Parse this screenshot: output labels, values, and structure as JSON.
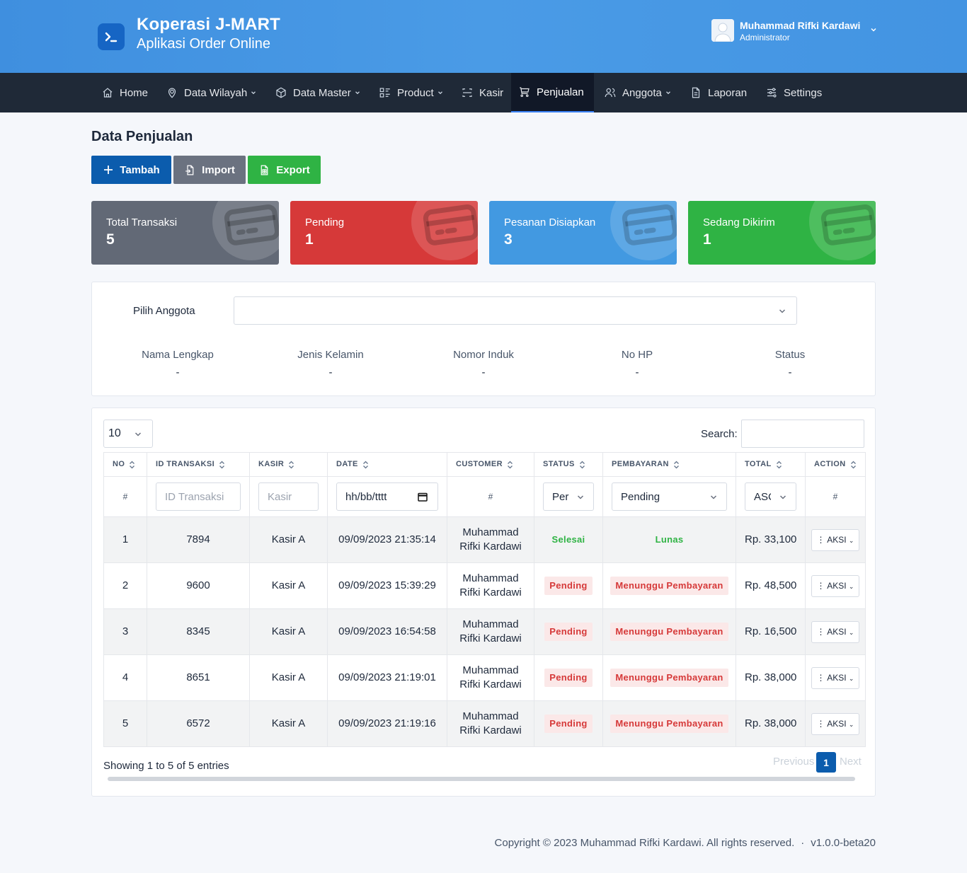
{
  "app": {
    "title": "Koperasi J-MART",
    "subtitle": "Aplikasi Order Online"
  },
  "user": {
    "name": "Muhammad Rifki Kardawi",
    "role": "Administrator"
  },
  "nav": [
    {
      "label": "Home",
      "icon": "home-icon",
      "dropdown": false
    },
    {
      "label": "Data Wilayah",
      "icon": "map-pin-icon",
      "dropdown": true
    },
    {
      "label": "Data Master",
      "icon": "box-icon",
      "dropdown": true
    },
    {
      "label": "Product",
      "icon": "list-details-icon",
      "dropdown": true
    },
    {
      "label": "Kasir",
      "icon": "scan-icon",
      "dropdown": false
    },
    {
      "label": "Penjualan",
      "icon": "cart-icon",
      "dropdown": false,
      "active": true
    },
    {
      "label": "Anggota",
      "icon": "users-icon",
      "dropdown": true
    },
    {
      "label": "Laporan",
      "icon": "file-icon",
      "dropdown": false
    },
    {
      "label": "Settings",
      "icon": "adjustments-icon",
      "dropdown": false
    }
  ],
  "page": {
    "title": "Data Penjualan",
    "buttons": {
      "tambah": "Tambah",
      "import": "Import",
      "export": "Export"
    }
  },
  "stats": [
    {
      "label": "Total Transaksi",
      "value": "5",
      "color": "#626976"
    },
    {
      "label": "Pending",
      "value": "1",
      "color": "#d63939"
    },
    {
      "label": "Pesanan Disiapkan",
      "value": "3",
      "color": "#4299e1"
    },
    {
      "label": "Sedang Dikirim",
      "value": "1",
      "color": "#2fb344"
    }
  ],
  "member": {
    "label": "Pilih Anggota",
    "select_value": "",
    "fields": [
      {
        "label": "Nama Lengkap",
        "value": "-"
      },
      {
        "label": "Jenis Kelamin",
        "value": "-"
      },
      {
        "label": "Nomor Induk",
        "value": "-"
      },
      {
        "label": "No HP",
        "value": "-"
      },
      {
        "label": "Status",
        "value": "-"
      }
    ]
  },
  "table": {
    "length": "10",
    "search_label": "Search:",
    "search_value": "",
    "columns": [
      "NO",
      "ID TRANSAKSI",
      "KASIR",
      "DATE",
      "CUSTOMER",
      "STATUS",
      "PEMBAYARAN",
      "TOTAL",
      "ACTION"
    ],
    "filters": {
      "no": "#",
      "id_placeholder": "ID Transaksi",
      "kasir_placeholder": "Kasir",
      "date_placeholder": "hh/bb/tttt",
      "customer": "#",
      "status": "Per",
      "pembayaran": "Pending",
      "total": "ASC",
      "action": "#"
    },
    "rows": [
      {
        "no": "1",
        "id": "7894",
        "kasir": "Kasir A",
        "date": "09/09/2023 21:35:14",
        "customer_1": "Muhammad",
        "customer_2": "Rifki Kardawi",
        "status": "Selesai",
        "pembayaran": "Lunas",
        "total": "Rp. 33,100",
        "aksi": "AKSI"
      },
      {
        "no": "2",
        "id": "9600",
        "kasir": "Kasir A",
        "date": "09/09/2023 15:39:29",
        "customer_1": "Muhammad",
        "customer_2": "Rifki Kardawi",
        "status": "Pending",
        "pembayaran": "Menunggu Pembayaran",
        "total": "Rp. 48,500",
        "aksi": "AKSI"
      },
      {
        "no": "3",
        "id": "8345",
        "kasir": "Kasir A",
        "date": "09/09/2023 16:54:58",
        "customer_1": "Muhammad",
        "customer_2": "Rifki Kardawi",
        "status": "Pending",
        "pembayaran": "Menunggu Pembayaran",
        "total": "Rp. 16,500",
        "aksi": "AKSI"
      },
      {
        "no": "4",
        "id": "8651",
        "kasir": "Kasir A",
        "date": "09/09/2023 21:19:01",
        "customer_1": "Muhammad",
        "customer_2": "Rifki Kardawi",
        "status": "Pending",
        "pembayaran": "Menunggu Pembayaran",
        "total": "Rp. 38,000",
        "aksi": "AKSI"
      },
      {
        "no": "5",
        "id": "6572",
        "kasir": "Kasir A",
        "date": "09/09/2023 21:19:16",
        "customer_1": "Muhammad",
        "customer_2": "Rifki Kardawi",
        "status": "Pending",
        "pembayaran": "Menunggu Pembayaran",
        "total": "Rp. 38,000",
        "aksi": "AKSI"
      }
    ],
    "showing": "Showing 1 to 5 of 5 entries",
    "pagination": {
      "prev": "Previous",
      "page": "1",
      "next": "Next"
    }
  },
  "footer": {
    "copyright": "Copyright © 2023 Muhammad Rifki Kardawi. All rights reserved.",
    "separator": "·",
    "version": "v1.0.0-beta20"
  }
}
